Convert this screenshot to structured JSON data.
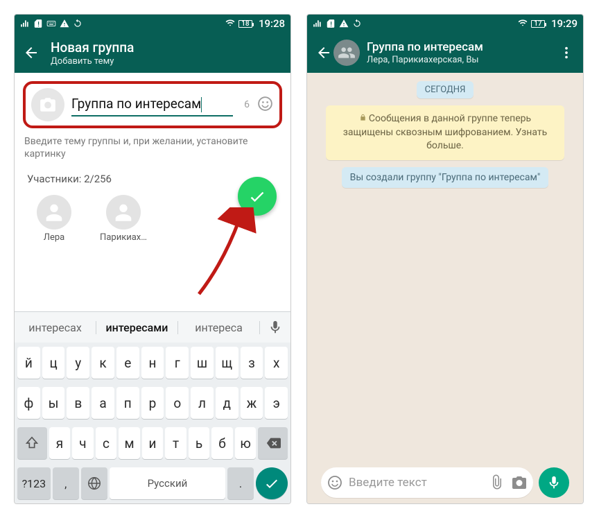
{
  "left": {
    "status": {
      "battery": "18",
      "time": "19:28"
    },
    "header": {
      "title": "Новая группа",
      "subtitle": "Добавить тему"
    },
    "group_name": "Группа по интересам",
    "chars_left": "6",
    "hint": "Введите тему группы и, при желании, установите картинку",
    "participants_label": "Участники: 2/256",
    "members": [
      {
        "name": "Лера"
      },
      {
        "name": "Парикиах…"
      }
    ],
    "suggestions": [
      "интересах",
      "интересами",
      "интереса"
    ],
    "keyboard": {
      "row1": [
        "й",
        "ц",
        "у",
        "к",
        "е",
        "н",
        "г",
        "ш",
        "щ",
        "з",
        "х"
      ],
      "row2": [
        "ф",
        "ы",
        "в",
        "а",
        "п",
        "р",
        "о",
        "л",
        "д",
        "ж",
        "э"
      ],
      "row3": [
        "я",
        "ч",
        "с",
        "м",
        "и",
        "т",
        "ь",
        "б",
        "ю"
      ],
      "numkey": "?123",
      "lang": "Русский"
    }
  },
  "right": {
    "status": {
      "battery": "17",
      "time": "19:29"
    },
    "header": {
      "title": "Группа по интересам",
      "subtitle": "Лера, Парикиахерская, Вы"
    },
    "date_pill": "СЕГОДНЯ",
    "encryption_notice": "Сообщения в данной группе теперь защищены сквозным шифрованием. Узнать больше.",
    "system_msg": "Вы создали группу \"Группа по интересам\"",
    "composer_placeholder": "Введите текст"
  }
}
